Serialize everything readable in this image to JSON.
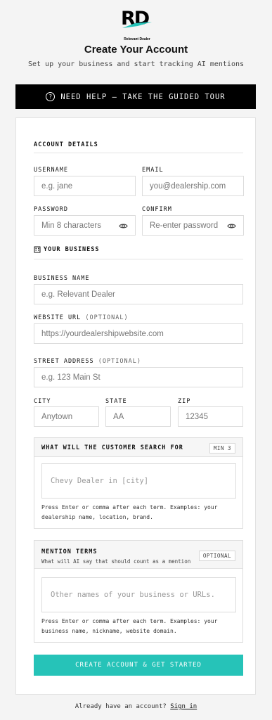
{
  "brand": {
    "letters": "RD",
    "tagline": "Relevant Dealer",
    "accent": "#26c3b8"
  },
  "header": {
    "title": "Create Your Account",
    "subtitle": "Set up your business and start tracking AI mentions"
  },
  "tour_banner": {
    "icon": "?",
    "label": "NEED HELP — TAKE THE GUIDED TOUR"
  },
  "account": {
    "heading": "ACCOUNT DETAILS",
    "username": {
      "label": "USERNAME",
      "placeholder": "e.g. jane"
    },
    "email": {
      "label": "EMAIL",
      "placeholder": "you@dealership.com"
    },
    "password": {
      "label": "PASSWORD",
      "placeholder": "Min 8 characters"
    },
    "confirm": {
      "label": "CONFIRM",
      "placeholder": "Re-enter password"
    }
  },
  "business": {
    "heading": "YOUR BUSINESS",
    "name": {
      "label": "BUSINESS NAME",
      "placeholder": "e.g. Relevant Dealer"
    },
    "website": {
      "label": "WEBSITE URL",
      "optional": "(OPTIONAL)",
      "placeholder": "https://yourdealershipwebsite.com"
    },
    "street": {
      "label": "STREET ADDRESS",
      "optional": "(OPTIONAL)",
      "placeholder": "e.g. 123 Main St"
    },
    "city": {
      "label": "CITY",
      "placeholder": "Anytown"
    },
    "state": {
      "label": "STATE",
      "placeholder": "AA"
    },
    "zip": {
      "label": "ZIP",
      "placeholder": "12345"
    }
  },
  "search_terms": {
    "heading": "WHAT WILL THE CUSTOMER SEARCH FOR",
    "badge": "MIN 3",
    "placeholder": "Chevy Dealer in [city]",
    "hint_line1": "Press Enter or comma after each term. Examples: your",
    "hint_line2": "dealership name, location, brand."
  },
  "mention_terms": {
    "heading": "MENTION TERMS",
    "subheading": "What will AI say that should count as a mention",
    "badge": "OPTIONAL",
    "placeholder": "Other names of your business or URLs.",
    "hint_line1": "Press Enter or comma after each term. Examples: your",
    "hint_line2": "business name, nickname, website domain."
  },
  "submit": {
    "label": "CREATE ACCOUNT & GET STARTED"
  },
  "footer": {
    "text": "Already have an account?",
    "link": "Sign in"
  }
}
